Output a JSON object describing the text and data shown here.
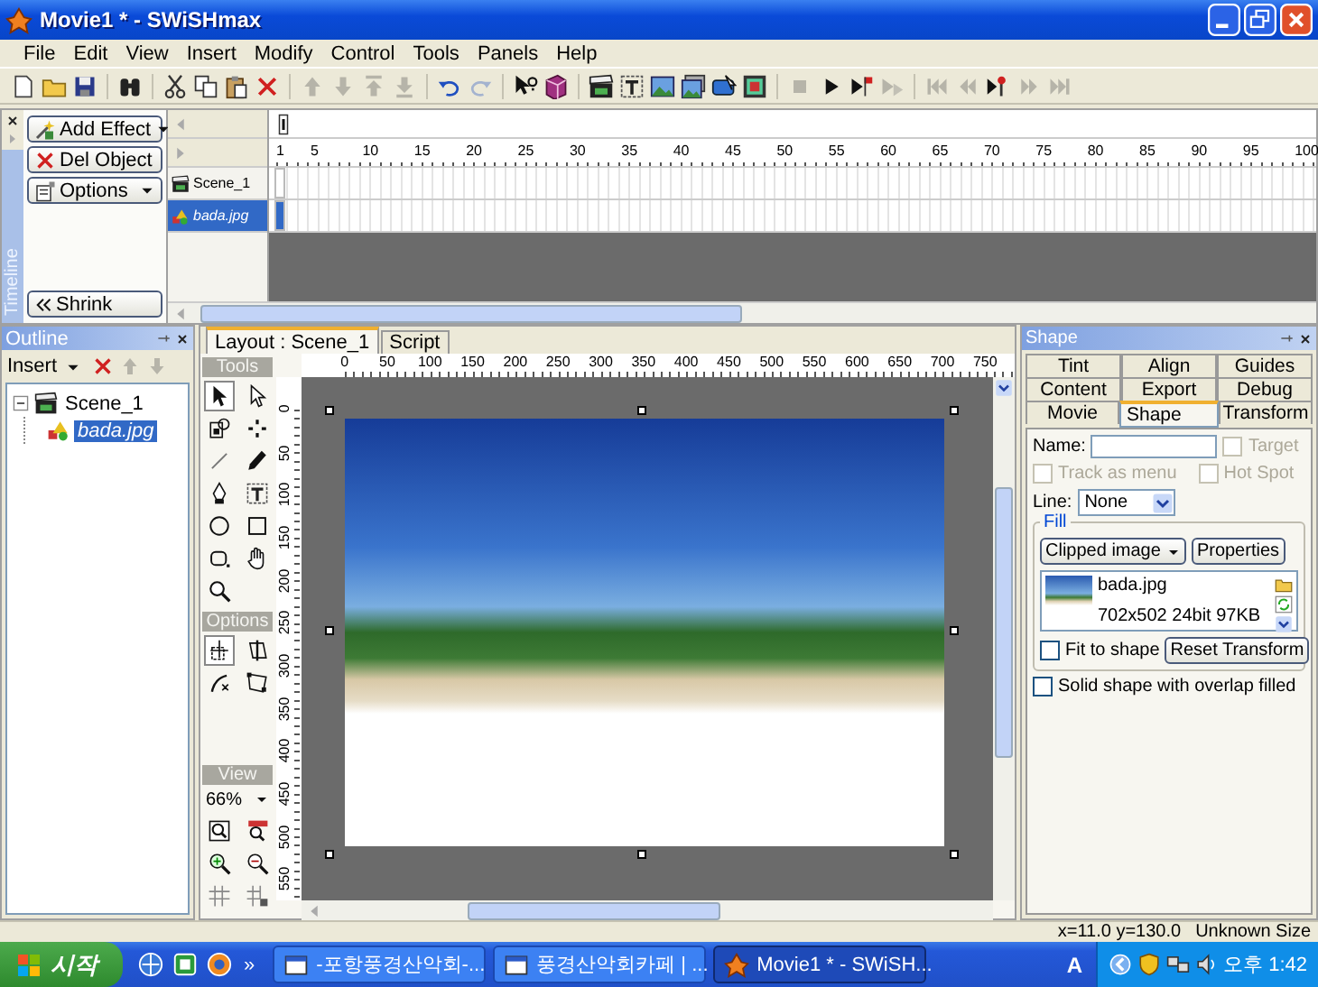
{
  "window": {
    "title": "Movie1 * - SWiSHmax"
  },
  "menu": [
    "File",
    "Edit",
    "View",
    "Insert",
    "Modify",
    "Control",
    "Tools",
    "Panels",
    "Help"
  ],
  "toolbar": [
    [
      {
        "kind": "page",
        "disabled": false
      },
      {
        "kind": "folder",
        "disabled": false
      },
      {
        "kind": "disk",
        "disabled": false
      }
    ],
    [
      {
        "kind": "binoculars",
        "disabled": false
      }
    ],
    [
      {
        "kind": "scissors",
        "disabled": false
      },
      {
        "kind": "copy",
        "disabled": false
      },
      {
        "kind": "paste",
        "disabled": false
      },
      {
        "kind": "x-mark",
        "disabled": false
      }
    ],
    [
      {
        "kind": "up-arrow",
        "disabled": true
      },
      {
        "kind": "down-arrow",
        "disabled": true
      },
      {
        "kind": "top-arrow",
        "disabled": true
      },
      {
        "kind": "bottom-arrow",
        "disabled": true
      }
    ],
    [
      {
        "kind": "undo",
        "disabled": false
      },
      {
        "kind": "redo",
        "disabled": true
      }
    ],
    [
      {
        "kind": "help-arrow",
        "disabled": false
      },
      {
        "kind": "book",
        "disabled": false
      }
    ],
    [
      {
        "kind": "clapperboard",
        "disabled": false
      },
      {
        "kind": "text-t",
        "disabled": false
      },
      {
        "kind": "picture",
        "disabled": false
      },
      {
        "kind": "picture-stack",
        "disabled": false
      },
      {
        "kind": "button-shape",
        "disabled": false
      },
      {
        "kind": "sprite-box",
        "disabled": false
      }
    ],
    [
      {
        "kind": "stop",
        "disabled": true
      },
      {
        "kind": "play",
        "disabled": false
      },
      {
        "kind": "play-flag",
        "disabled": false
      },
      {
        "kind": "play-faded",
        "disabled": true
      }
    ],
    [
      {
        "kind": "first",
        "disabled": true
      },
      {
        "kind": "prev",
        "disabled": true
      },
      {
        "kind": "marker",
        "disabled": false
      },
      {
        "kind": "next",
        "disabled": true
      },
      {
        "kind": "last",
        "disabled": true
      }
    ]
  ],
  "timeline": {
    "label": "Timeline",
    "buttons": [
      {
        "label": "Add Effect",
        "kind": "effect"
      },
      {
        "label": "Del Object",
        "kind": "delete"
      },
      {
        "label": "Options",
        "kind": "options"
      }
    ],
    "shrink": "Shrink",
    "layers": [
      {
        "name": "Scene_1",
        "kind": "scene",
        "selected": false
      },
      {
        "name": "bada.jpg",
        "kind": "image",
        "selected": true
      }
    ],
    "ruler": [
      "1",
      "5",
      "10",
      "15",
      "20",
      "25",
      "30",
      "35",
      "40",
      "45",
      "50",
      "55",
      "60",
      "65",
      "70",
      "75",
      "80",
      "85",
      "90",
      "95",
      "100"
    ]
  },
  "outline": {
    "title": "Outline",
    "insert": "Insert",
    "tools": [
      {
        "kind": "x-mark",
        "disabled": false
      },
      {
        "kind": "up-arrow",
        "disabled": true
      },
      {
        "kind": "down-arrow",
        "disabled": true
      }
    ],
    "tree": [
      {
        "label": "Scene_1",
        "kind": "scene",
        "expanded": true,
        "selected": false,
        "children": [
          {
            "label": "bada.jpg",
            "kind": "image",
            "selected": true
          }
        ]
      }
    ]
  },
  "layout": {
    "tabs": [
      {
        "label": "Layout : Scene_1",
        "selected": true
      },
      {
        "label": "Script",
        "selected": false
      }
    ],
    "tools_title": "Tools",
    "tools": [
      {
        "kind": "pointer",
        "selected": true
      },
      {
        "kind": "subselect",
        "selected": false
      },
      {
        "kind": "fill-transform",
        "selected": false
      },
      {
        "kind": "reshape",
        "selected": false
      },
      {
        "kind": "line",
        "selected": false
      },
      {
        "kind": "pencil",
        "selected": false
      },
      {
        "kind": "pen",
        "selected": false
      },
      {
        "kind": "text-t",
        "selected": false
      },
      {
        "kind": "ellipse",
        "selected": false
      },
      {
        "kind": "rectangle",
        "selected": false
      },
      {
        "kind": "rounded-rect",
        "selected": false
      },
      {
        "kind": "hand",
        "selected": false
      },
      {
        "kind": "zoom",
        "selected": false
      }
    ],
    "options_title": "Options",
    "options": [
      {
        "kind": "resize",
        "selected": true
      },
      {
        "kind": "skew",
        "selected": false
      },
      {
        "kind": "bend",
        "selected": false
      },
      {
        "kind": "distort",
        "selected": false
      }
    ],
    "view_title": "View",
    "zoom": "66%",
    "view_tools": [
      {
        "kind": "zoom-fit",
        "selected": false
      },
      {
        "kind": "zoom-100",
        "selected": false
      },
      {
        "kind": "zoom-in",
        "selected": false
      },
      {
        "kind": "zoom-out",
        "selected": false
      },
      {
        "kind": "grid",
        "selected": false
      },
      {
        "kind": "snap",
        "selected": false
      }
    ],
    "hruler": [
      "0",
      "50",
      "100",
      "150",
      "200",
      "250",
      "300",
      "350",
      "400",
      "450",
      "500",
      "550",
      "600",
      "650",
      "700",
      "750"
    ],
    "vruler": [
      "0",
      "50",
      "100",
      "150",
      "200",
      "250",
      "300",
      "350",
      "400",
      "450",
      "500",
      "550"
    ]
  },
  "shape": {
    "title": "Shape",
    "tabs": [
      [
        {
          "label": "Tint",
          "selected": false
        },
        {
          "label": "Align",
          "selected": false
        },
        {
          "label": "Guides",
          "selected": false
        }
      ],
      [
        {
          "label": "Content",
          "selected": false
        },
        {
          "label": "Export",
          "selected": false
        },
        {
          "label": "Debug",
          "selected": false
        }
      ],
      [
        {
          "label": "Movie",
          "selected": false
        },
        {
          "label": "Shape",
          "selected": true
        },
        {
          "label": "Transform",
          "selected": false
        }
      ]
    ],
    "name_label": "Name:",
    "target": {
      "label": "Target",
      "checked": false,
      "disabled": true
    },
    "track": {
      "label": "Track as menu",
      "checked": false,
      "disabled": true
    },
    "hotspot": {
      "label": "Hot Spot",
      "checked": false,
      "disabled": true
    },
    "line_label": "Line:",
    "line_value": "None",
    "fill": {
      "title": "Fill",
      "type": "Clipped image",
      "properties": "Properties",
      "file": "bada.jpg",
      "info": "702x502 24bit 97KB",
      "fit": {
        "label": "Fit to shape",
        "checked": false,
        "disabled": false
      },
      "reset": "Reset Transform"
    },
    "solid": {
      "label": "Solid shape with overlap filled",
      "checked": false,
      "disabled": false
    }
  },
  "status": {
    "coords": "x=11.0 y=130.0",
    "size": "Unknown Size"
  },
  "taskbar": {
    "start": "시작",
    "overflow": "»",
    "tasks": [
      {
        "label": "-포항풍경산악회-...",
        "selected": false
      },
      {
        "label": "풍경산악회카페 | ...",
        "selected": false
      },
      {
        "label": "Movie1 * - SWiSH...",
        "selected": true
      }
    ],
    "ime": "A",
    "clock": "오후 1:42"
  }
}
